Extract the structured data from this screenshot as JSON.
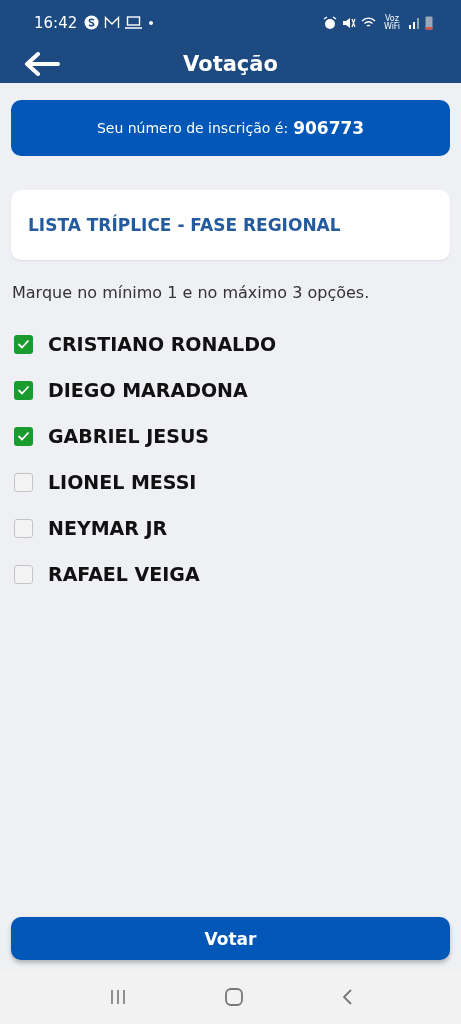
{
  "status_bar": {
    "time": "16:42",
    "network_label": "Voz WiFi"
  },
  "header": {
    "title": "Votação"
  },
  "registration": {
    "label": "Seu número de inscrição é:",
    "number": "906773"
  },
  "section": {
    "title": "LISTA TRÍPLICE - FASE REGIONAL"
  },
  "instruction": "Marque no mínimo 1 e no máximo 3 opções.",
  "options": [
    {
      "label": "CRISTIANO RONALDO",
      "checked": true
    },
    {
      "label": "DIEGO MARADONA",
      "checked": true
    },
    {
      "label": "GABRIEL JESUS",
      "checked": true
    },
    {
      "label": "LIONEL MESSI",
      "checked": false
    },
    {
      "label": "NEYMAR JR",
      "checked": false
    },
    {
      "label": "RAFAEL VEIGA",
      "checked": false
    }
  ],
  "vote_button": "Votar"
}
